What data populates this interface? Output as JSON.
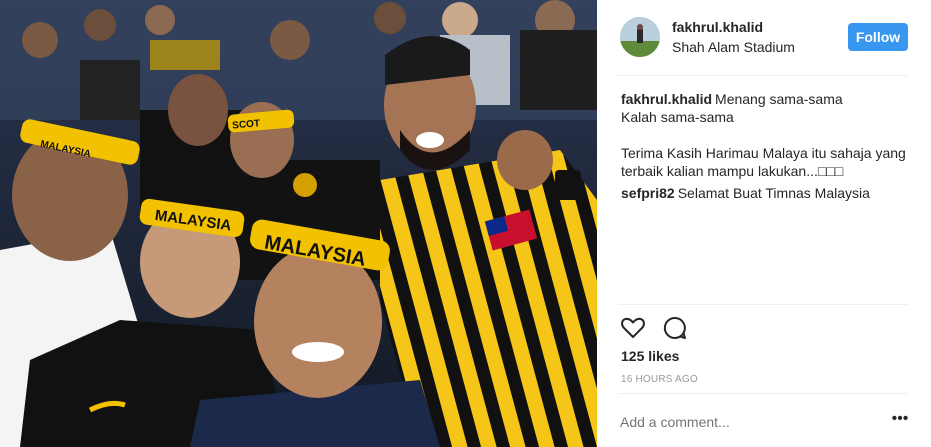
{
  "post": {
    "username": "fakhrul.khalid",
    "location": "Shah Alam Stadium",
    "follow_label": "Follow",
    "caption_lines": [
      "Menang sama-sama",
      "Kalah sama-sama",
      "",
      "Terima Kasih Harimau Malaya itu sahaja yang",
      "terbaik kalian mampu lakukan...□□□"
    ],
    "comments": [
      {
        "user": "sefpri82",
        "text": "Selamat Buat Timnas Malaysia"
      }
    ],
    "likes": "125 likes",
    "timestamp": "16 HOURS AGO",
    "add_comment_placeholder": "Add a comment...",
    "more_icon": "•••",
    "icons": [
      "heart-icon",
      "comment-icon"
    ]
  },
  "photo": {
    "headband_texts": [
      "MALAYSIA",
      "MALAYSIA",
      "MALAYSIA",
      "SCOT"
    ],
    "colors": {
      "jersey_yellow": "#f5c518",
      "jersey_black": "#111111",
      "follow_blue": "#3897f0"
    }
  }
}
